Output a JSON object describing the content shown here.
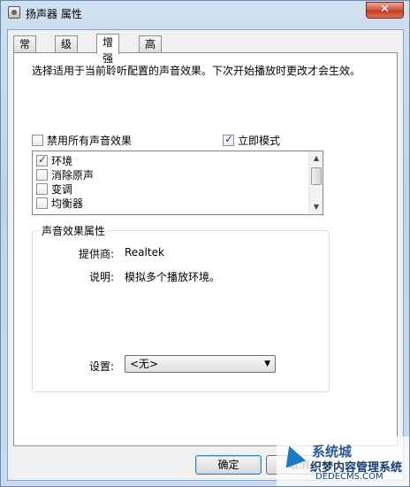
{
  "window": {
    "title": "扬声器 属性",
    "close_glyph": "✕"
  },
  "tabs": [
    {
      "label": "常规",
      "active": false
    },
    {
      "label": "级别",
      "active": false
    },
    {
      "label": "增强",
      "active": true
    },
    {
      "label": "高级",
      "active": false
    }
  ],
  "enhancements": {
    "description": "选择适用于当前聆听配置的声音效果。下次开始播放时更改才会生效。",
    "disable_all": {
      "label": "禁用所有声音效果",
      "checked": false
    },
    "immediate_mode": {
      "label": "立即模式",
      "checked": true
    },
    "list": [
      {
        "label": "环境",
        "checked": true
      },
      {
        "label": "消除原声",
        "checked": false
      },
      {
        "label": "变调",
        "checked": false
      },
      {
        "label": "均衡器",
        "checked": false
      }
    ]
  },
  "properties": {
    "group_title": "声音效果属性",
    "provider_label": "提供商:",
    "provider_value": "Realtek",
    "description_label": "说明:",
    "description_value": "模拟多个播放环境。",
    "setting_label": "设置:",
    "setting_value": "<无>"
  },
  "buttons": {
    "ok": "确定",
    "cancel": "取消"
  },
  "watermark": {
    "text1": "系统城",
    "text2": "织梦内容管理系统",
    "text3": "DEDECMS.COM"
  }
}
